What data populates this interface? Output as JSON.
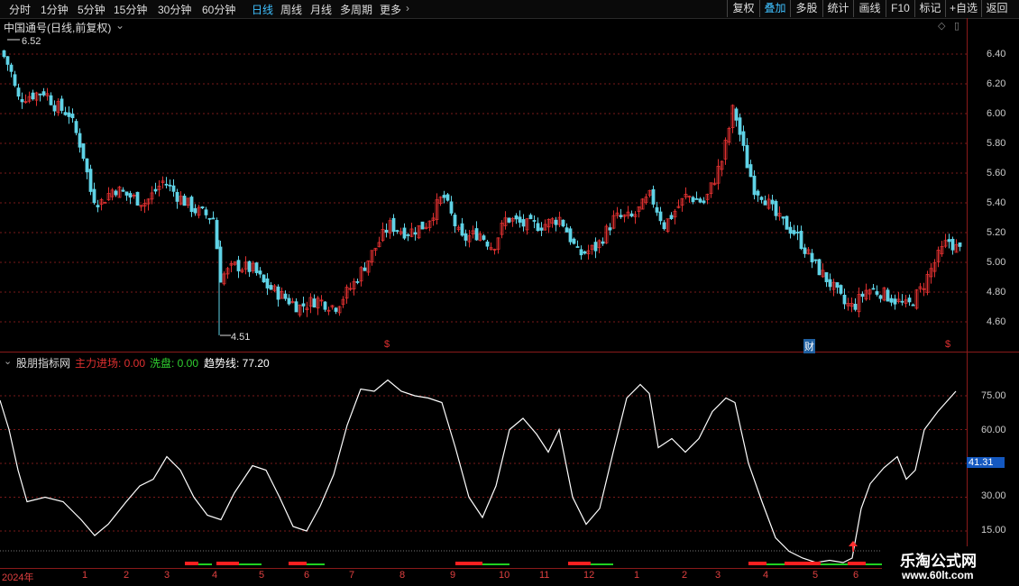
{
  "toolbar": {
    "periods": [
      "分时",
      "1分钟",
      "5分钟",
      "15分钟",
      "30分钟",
      "60分钟",
      "日线",
      "周线",
      "月线",
      "多周期",
      "更多"
    ],
    "active_period": "日线",
    "right_buttons": [
      "复权",
      "叠加",
      "多股",
      "统计",
      "画线",
      "F10",
      "标记",
      "+自选",
      "返回"
    ],
    "active_right": "叠加"
  },
  "main_pane": {
    "title": "中国通号(日线,前复权)",
    "high_label": "6.52",
    "low_label": "4.51",
    "y_ticks": [
      "6.40",
      "6.20",
      "6.00",
      "5.80",
      "5.60",
      "5.40",
      "5.20",
      "5.00",
      "4.80",
      "4.60"
    ],
    "markers": [
      "$",
      "财",
      "$"
    ]
  },
  "indicator_pane": {
    "name": "股朋指标网",
    "line1_label": "主力进场: 0.00",
    "line2_label": "洗盘: 0.00",
    "line3_label": "趋势线: 77.20",
    "y_ticks": [
      "75.00",
      "60.00",
      "41.31",
      "30.00",
      "15.00"
    ],
    "current_value": "41.31"
  },
  "date_axis": {
    "labels": [
      "2024年",
      "1",
      "2",
      "3",
      "4",
      "5",
      "6",
      "7",
      "8",
      "9",
      "10",
      "11",
      "12",
      "1",
      "2",
      "3",
      "4",
      "5",
      "6"
    ]
  },
  "watermark": {
    "title": "乐淘公式网",
    "url": "www.60lt.com"
  },
  "colors": {
    "up": "#e03030",
    "down": "#5fd3e6",
    "trend": "#ffffff",
    "grid": "#7a1a1a"
  }
}
